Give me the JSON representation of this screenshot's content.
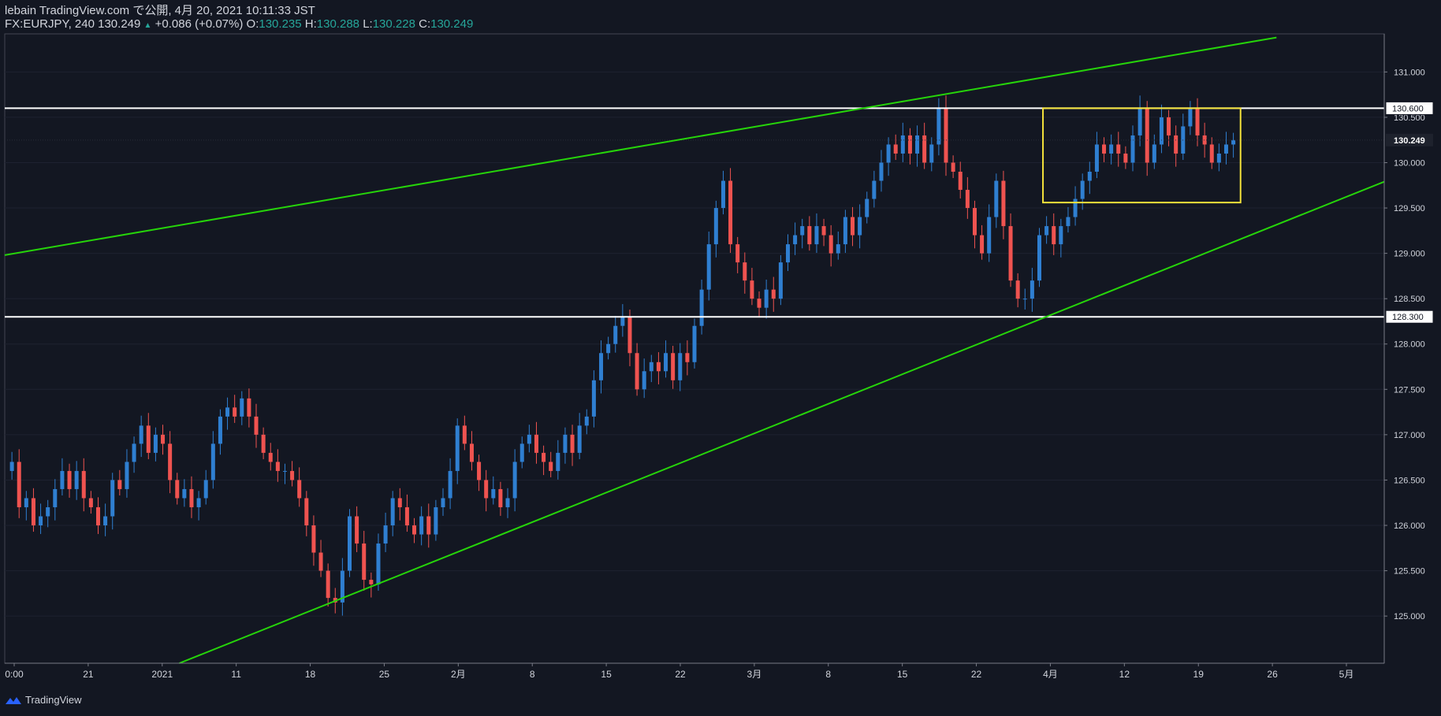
{
  "header": {
    "publisher_line": "lebain TradingView.com で公開, 4月 20, 2021 10:11:33 JST",
    "symbol": "FX:EURJPY, 240",
    "last": "130.249",
    "change": "+0.086 (+0.07%)",
    "o_label": "O:",
    "o_value": "130.235",
    "h_label": "H:",
    "h_value": "130.288",
    "l_label": "L:",
    "l_value": "130.228",
    "c_label": "C:",
    "c_value": "130.249"
  },
  "footer": {
    "brand": "TradingView"
  },
  "colors": {
    "background": "#131722",
    "up": "#2f7fd1",
    "down": "#ef5350",
    "trendline": "#26d40a",
    "level": "#ffffff",
    "box": "#f5e33b",
    "text": "#d1d4dc"
  },
  "chart_data": {
    "type": "candlestick",
    "ylim": [
      124.48,
      131.42
    ],
    "y_ticks": [
      "125.000",
      "125.500",
      "126.000",
      "126.500",
      "127.000",
      "127.500",
      "128.000",
      "128.500",
      "129.000",
      "129.500",
      "130.000",
      "130.500",
      "131.000"
    ],
    "x_ticks": [
      "0:00",
      "21",
      "2021",
      "11",
      "18",
      "25",
      "2月",
      "8",
      "15",
      "22",
      "3月",
      "8",
      "15",
      "22",
      "4月",
      "12",
      "19",
      "26",
      "5月"
    ],
    "last_price": {
      "label": "130.249",
      "value": 130.249
    },
    "horizontal_levels": [
      {
        "label": "130.600",
        "value": 130.6
      },
      {
        "label": "128.300",
        "value": 128.3
      }
    ],
    "trendlines": [
      {
        "from": {
          "x": 0,
          "y": 128.98
        },
        "to": {
          "x": 177,
          "y": 131.38
        }
      },
      {
        "from": {
          "x": 24.3,
          "y": 124.48
        },
        "to": {
          "x": 192,
          "y": 129.79
        }
      }
    ],
    "range_box": {
      "x": [
        144.5,
        172
      ],
      "y": [
        129.56,
        130.6
      ]
    },
    "price_path": [
      [
        0,
        126.6
      ],
      [
        1,
        126.7
      ],
      [
        2,
        126.2
      ],
      [
        3,
        126.3
      ],
      [
        4,
        126.0
      ],
      [
        5,
        126.1
      ],
      [
        6,
        126.2
      ],
      [
        7,
        126.4
      ],
      [
        8,
        126.6
      ],
      [
        9,
        126.4
      ],
      [
        10,
        126.6
      ],
      [
        11,
        126.3
      ],
      [
        12,
        126.2
      ],
      [
        13,
        126.0
      ],
      [
        14,
        126.1
      ],
      [
        15,
        126.5
      ],
      [
        16,
        126.4
      ],
      [
        17,
        126.7
      ],
      [
        18,
        126.9
      ],
      [
        19,
        127.1
      ],
      [
        20,
        126.8
      ],
      [
        21,
        127.0
      ],
      [
        22,
        126.9
      ],
      [
        23,
        126.5
      ],
      [
        24,
        126.3
      ],
      [
        25,
        126.4
      ],
      [
        26,
        126.2
      ],
      [
        27,
        126.3
      ],
      [
        28,
        126.5
      ],
      [
        29,
        126.9
      ],
      [
        30,
        127.2
      ],
      [
        31,
        127.3
      ],
      [
        32,
        127.2
      ],
      [
        33,
        127.4
      ],
      [
        34,
        127.2
      ],
      [
        35,
        127.0
      ],
      [
        36,
        126.8
      ],
      [
        37,
        126.7
      ],
      [
        38,
        126.6
      ],
      [
        39,
        126.6
      ],
      [
        40,
        126.5
      ],
      [
        41,
        126.3
      ],
      [
        42,
        126.0
      ],
      [
        43,
        125.7
      ],
      [
        44,
        125.5
      ],
      [
        45,
        125.2
      ],
      [
        46,
        125.15
      ],
      [
        47,
        125.5
      ],
      [
        48,
        126.1
      ],
      [
        49,
        125.8
      ],
      [
        50,
        125.4
      ],
      [
        51,
        125.35
      ],
      [
        52,
        125.8
      ],
      [
        53,
        126.0
      ],
      [
        54,
        126.3
      ],
      [
        55,
        126.2
      ],
      [
        56,
        126.0
      ],
      [
        57,
        125.9
      ],
      [
        58,
        126.1
      ],
      [
        59,
        125.9
      ],
      [
        60,
        126.2
      ],
      [
        61,
        126.3
      ],
      [
        62,
        126.6
      ],
      [
        63,
        127.1
      ],
      [
        64,
        126.9
      ],
      [
        65,
        126.7
      ],
      [
        66,
        126.5
      ],
      [
        67,
        126.3
      ],
      [
        68,
        126.4
      ],
      [
        69,
        126.2
      ],
      [
        70,
        126.3
      ],
      [
        71,
        126.7
      ],
      [
        72,
        126.9
      ],
      [
        73,
        127.0
      ],
      [
        74,
        126.8
      ],
      [
        75,
        126.7
      ],
      [
        76,
        126.6
      ],
      [
        77,
        126.8
      ],
      [
        78,
        127.0
      ],
      [
        79,
        126.8
      ],
      [
        80,
        127.1
      ],
      [
        81,
        127.2
      ],
      [
        82,
        127.6
      ],
      [
        83,
        127.9
      ],
      [
        84,
        128.0
      ],
      [
        85,
        128.2
      ],
      [
        86,
        128.3
      ],
      [
        87,
        127.9
      ],
      [
        88,
        127.5
      ],
      [
        89,
        127.7
      ],
      [
        90,
        127.8
      ],
      [
        91,
        127.7
      ],
      [
        92,
        127.9
      ],
      [
        93,
        127.6
      ],
      [
        94,
        127.9
      ],
      [
        95,
        127.8
      ],
      [
        96,
        128.2
      ],
      [
        97,
        128.6
      ],
      [
        98,
        129.1
      ],
      [
        99,
        129.5
      ],
      [
        100,
        129.8
      ],
      [
        101,
        129.1
      ],
      [
        102,
        128.9
      ],
      [
        103,
        128.7
      ],
      [
        104,
        128.5
      ],
      [
        105,
        128.4
      ],
      [
        106,
        128.6
      ],
      [
        107,
        128.5
      ],
      [
        108,
        128.9
      ],
      [
        109,
        129.1
      ],
      [
        110,
        129.2
      ],
      [
        111,
        129.3
      ],
      [
        112,
        129.1
      ],
      [
        113,
        129.3
      ],
      [
        114,
        129.2
      ],
      [
        115,
        129.0
      ],
      [
        116,
        129.1
      ],
      [
        117,
        129.4
      ],
      [
        118,
        129.2
      ],
      [
        119,
        129.4
      ],
      [
        120,
        129.6
      ],
      [
        121,
        129.8
      ],
      [
        122,
        130.0
      ],
      [
        123,
        130.2
      ],
      [
        124,
        130.1
      ],
      [
        125,
        130.3
      ],
      [
        126,
        130.1
      ],
      [
        127,
        130.3
      ],
      [
        128,
        130.0
      ],
      [
        129,
        130.2
      ],
      [
        130,
        130.6
      ],
      [
        131,
        130.0
      ],
      [
        132,
        129.9
      ],
      [
        133,
        129.7
      ],
      [
        134,
        129.5
      ],
      [
        135,
        129.2
      ],
      [
        136,
        129.0
      ],
      [
        137,
        129.4
      ],
      [
        138,
        129.8
      ],
      [
        139,
        129.3
      ],
      [
        140,
        128.7
      ],
      [
        141,
        128.5
      ],
      [
        142,
        128.5
      ],
      [
        143,
        128.7
      ],
      [
        144,
        129.2
      ],
      [
        145,
        129.3
      ],
      [
        146,
        129.1
      ],
      [
        147,
        129.3
      ],
      [
        148,
        129.4
      ],
      [
        149,
        129.6
      ],
      [
        150,
        129.8
      ],
      [
        151,
        129.9
      ],
      [
        152,
        130.2
      ],
      [
        153,
        130.1
      ],
      [
        154,
        130.2
      ],
      [
        155,
        130.1
      ],
      [
        156,
        130.0
      ],
      [
        157,
        130.3
      ],
      [
        158,
        130.6
      ],
      [
        159,
        130.0
      ],
      [
        160,
        130.2
      ],
      [
        161,
        130.5
      ],
      [
        162,
        130.3
      ],
      [
        163,
        130.1
      ],
      [
        164,
        130.4
      ],
      [
        165,
        130.6
      ],
      [
        166,
        130.3
      ],
      [
        167,
        130.2
      ],
      [
        168,
        130.0
      ],
      [
        169,
        130.1
      ],
      [
        170,
        130.2
      ],
      [
        171,
        130.249
      ]
    ],
    "x_range": [
      0,
      192
    ]
  }
}
